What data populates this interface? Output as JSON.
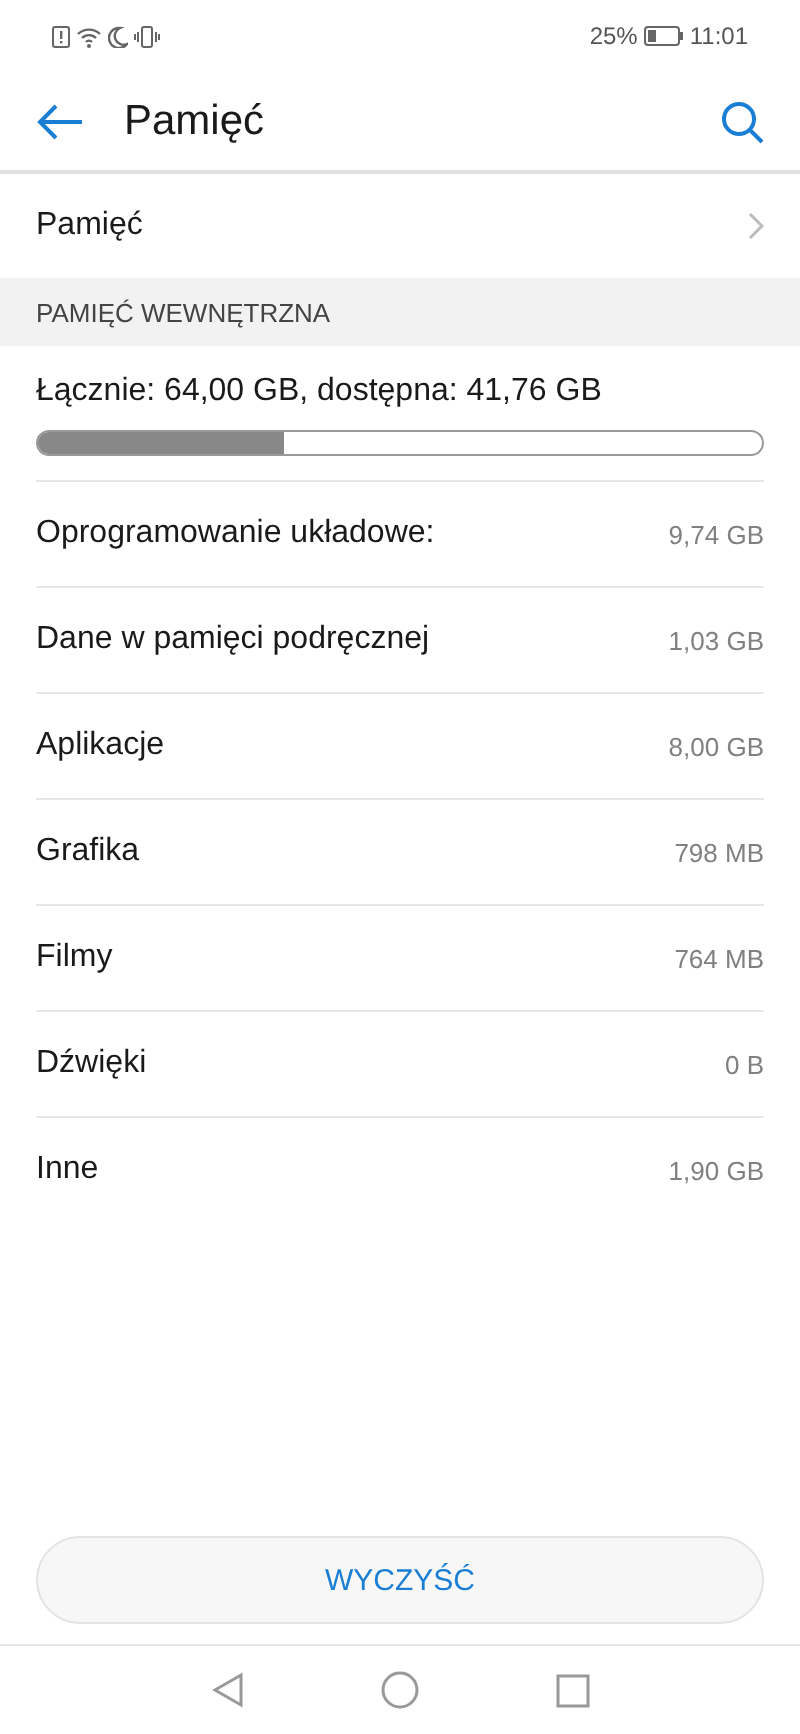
{
  "status_bar": {
    "battery_text": "25%",
    "time": "11:01"
  },
  "header": {
    "title": "Pamięć"
  },
  "nav_row": {
    "label": "Pamięć"
  },
  "section": {
    "title": "PAMIĘĆ WEWNĘTRZNA",
    "summary": "Łącznie: 64,00 GB, dostępna: 41,76 GB",
    "level": 0.34
  },
  "items": [
    {
      "label": "Oprogramowanie układowe:",
      "value": "9,74 GB"
    },
    {
      "label": "Dane w pamięci podręcznej",
      "value": "1,03 GB"
    },
    {
      "label": "Aplikacje",
      "value": "8,00 GB"
    },
    {
      "label": "Grafika",
      "value": "798 MB"
    },
    {
      "label": "Filmy",
      "value": "764 MB"
    },
    {
      "label": "Dźwięki",
      "value": "0 B"
    },
    {
      "label": "Inne",
      "value": "1,90 GB"
    }
  ],
  "button": {
    "label": "WYCZYŚĆ"
  }
}
